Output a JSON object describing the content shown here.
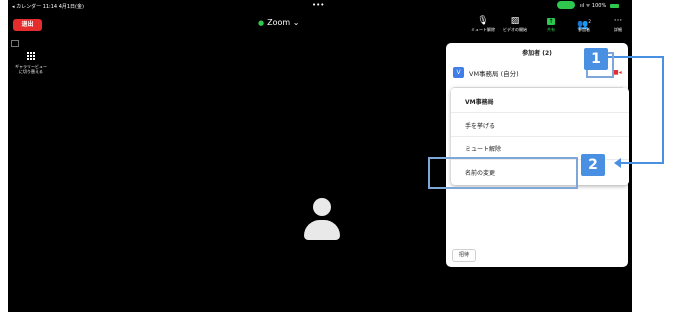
{
  "status_bar": {
    "left": "◂ カレンダー  11:14  4月1日(金)",
    "dots": "•••",
    "right": "100%"
  },
  "toolbar": {
    "leave_label": "退出",
    "meeting_title": "Zoom ⌄",
    "mute_label": "ミュート解除",
    "video_label": "ビデオの開始",
    "share_label": "共有",
    "participants_label": "参加者",
    "participants_count": "2",
    "more_label": "詳細"
  },
  "sidebar": {
    "gallery_label": "ギャラリービューに切り替える"
  },
  "participants_panel": {
    "title": "参加者 (2)",
    "participant_initial": "V",
    "participant_name": "VM事務局 (自分)",
    "invite_label": "招待"
  },
  "context_menu": {
    "header": "VM事務局",
    "items": [
      "手を挙げる",
      "ミュート解除",
      "名前の変更"
    ]
  },
  "annotations": {
    "badge_1": "1",
    "badge_2": "2",
    "accent_color": "#4a90e2"
  },
  "colors": {
    "leave_red": "#e52d2d",
    "share_green": "#2ec84f",
    "participant_blue": "#3f7ee8"
  }
}
